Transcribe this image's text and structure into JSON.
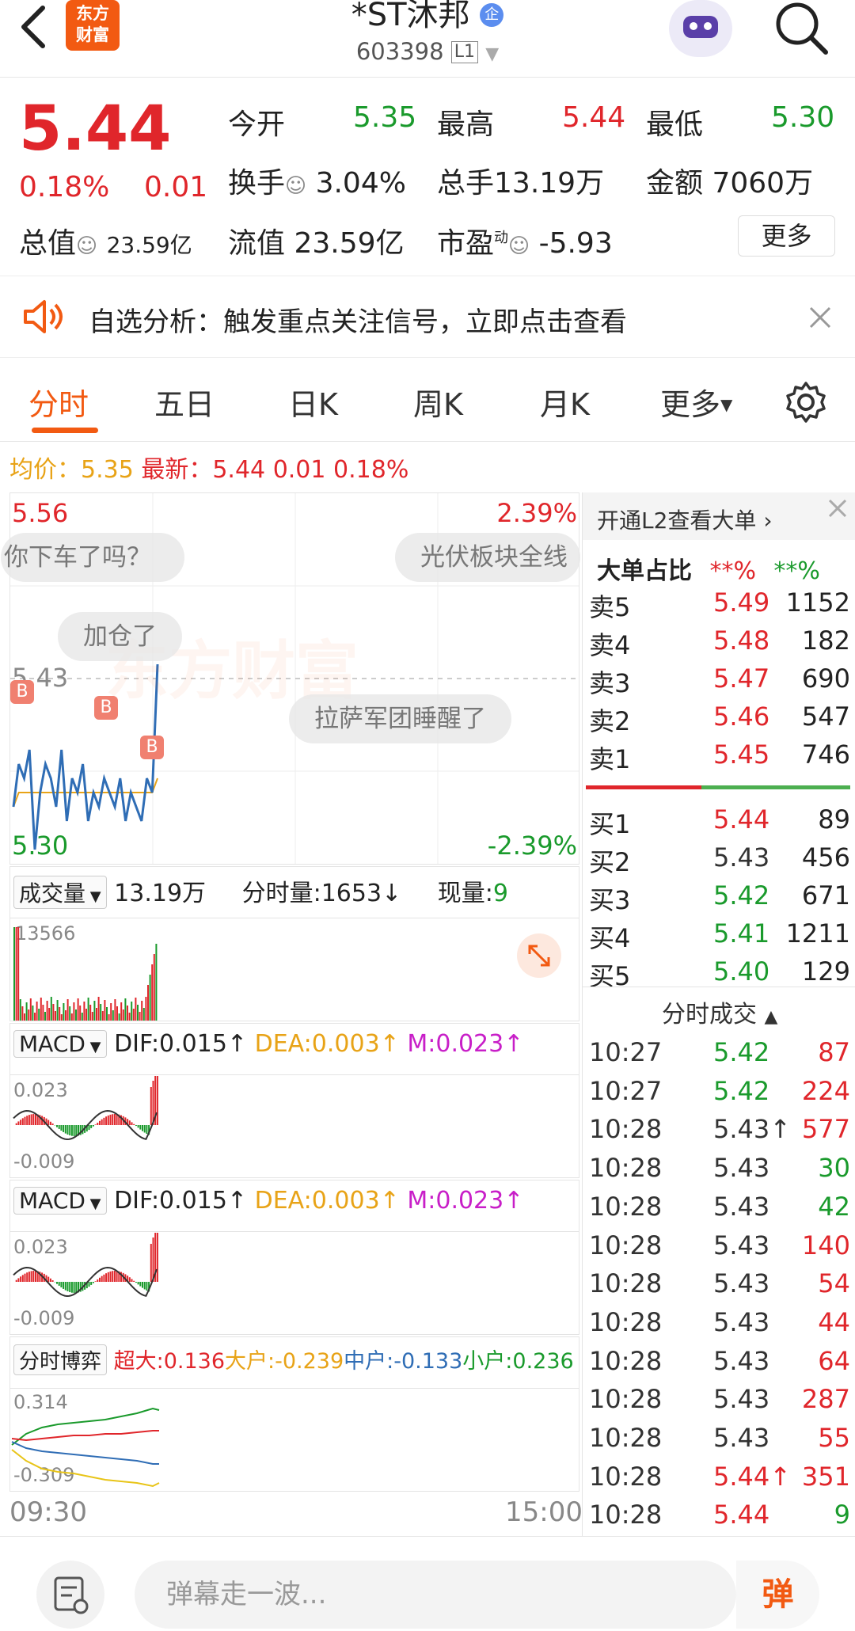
{
  "header": {
    "title": "*ST沐邦",
    "code": "603398",
    "level": "L1",
    "logo": [
      "东方",
      "财富"
    ]
  },
  "quote": {
    "price": "5.44",
    "change_pct": "0.18%",
    "change": "0.01",
    "open_label": "今开",
    "open": "5.35",
    "high_label": "最高",
    "high": "5.44",
    "low_label": "最低",
    "low": "5.30",
    "turnover_label": "换手",
    "turnover": "3.04%",
    "volume_label": "总手",
    "volume": "13.19万",
    "amount_label": "金额",
    "amount": "7060万",
    "mktcap_label": "总值",
    "mktcap": "23.59亿",
    "float_label": "流值",
    "float": "23.59亿",
    "pe_label": "市盈",
    "pe_sup": "动",
    "pe": "-5.93",
    "more": "更多"
  },
  "banner": {
    "text": "自选分析：触发重点关注信号，立即点击查看"
  },
  "tabs": [
    "分时",
    "五日",
    "日K",
    "周K",
    "月K",
    "更多"
  ],
  "avg_line": {
    "avg_label": "均价：",
    "avg": "5.35",
    "latest_label": "最新：",
    "latest": "5.44",
    "chg": "0.01",
    "pct": "0.18%"
  },
  "chart": {
    "top_price": "5.56",
    "top_pct": "2.39%",
    "mid_price": "5.43",
    "bottom_price": "5.30",
    "bottom_pct": "-2.39%",
    "start_time": "09:30",
    "end_time": "15:00",
    "watermark": "东方财富",
    "bubbles": [
      "你下车了吗？",
      "光伏板块全线",
      "加仓了",
      "拉萨军团睡醒了"
    ],
    "buy_marker": "B"
  },
  "chart_data": {
    "type": "line",
    "title": "",
    "series": [
      {
        "values": [
          5.34,
          5.37,
          5.36,
          5.38,
          5.31,
          5.35,
          5.37,
          5.36,
          5.34,
          5.38,
          5.33,
          5.36,
          5.35,
          5.37,
          5.33,
          5.35,
          5.34,
          5.36,
          5.35,
          5.34,
          5.36,
          5.33,
          5.35,
          5.34,
          5.33,
          5.36,
          5.35,
          5.44
        ]
      },
      {
        "values": [
          5.34,
          5.35,
          5.35,
          5.35,
          5.35,
          5.35,
          5.35,
          5.35,
          5.35,
          5.35,
          5.35,
          5.35,
          5.35,
          5.35,
          5.35,
          5.35,
          5.35,
          5.35,
          5.35,
          5.35,
          5.35,
          5.35,
          5.35,
          5.35,
          5.35,
          5.35,
          5.35,
          5.36
        ]
      }
    ],
    "ylim": [
      5.3,
      5.56
    ]
  },
  "volume": {
    "label": "成交量",
    "total": "13.19万",
    "min_label": "分时量:",
    "min_val": "1653",
    "now_label": "现量:",
    "now_val": "9",
    "max": "13566"
  },
  "macd1": {
    "label": "MACD",
    "dif": "DIF:0.015↑",
    "dea": "DEA:0.003↑",
    "m": "M:0.023↑",
    "top": "0.023",
    "bottom": "-0.009"
  },
  "macd2": {
    "label": "MACD",
    "dif": "DIF:0.015↑",
    "dea": "DEA:0.003↑",
    "m": "M:0.023↑",
    "top": "0.023",
    "bottom": "-0.009"
  },
  "game": {
    "label": "分时博弈",
    "super": "超大:0.136",
    "big": "大户:-0.239",
    "mid": "中户:-0.133",
    "small": "小户:0.236",
    "top": "0.314",
    "bottom": "-0.309"
  },
  "orderbook": {
    "l2_text": "开通L2查看大单",
    "big_order_label": "大单占比",
    "big_red": "**%",
    "big_green": "**%",
    "asks": [
      {
        "label": "卖5",
        "price": "5.49",
        "vol": "1152"
      },
      {
        "label": "卖4",
        "price": "5.48",
        "vol": "182"
      },
      {
        "label": "卖3",
        "price": "5.47",
        "vol": "690"
      },
      {
        "label": "卖2",
        "price": "5.46",
        "vol": "547"
      },
      {
        "label": "卖1",
        "price": "5.45",
        "vol": "746"
      }
    ],
    "bids": [
      {
        "label": "买1",
        "price": "5.44",
        "vol": "89"
      },
      {
        "label": "买2",
        "price": "5.43",
        "vol": "456"
      },
      {
        "label": "买3",
        "price": "5.42",
        "vol": "671"
      },
      {
        "label": "买4",
        "price": "5.41",
        "vol": "1211"
      },
      {
        "label": "买5",
        "price": "5.40",
        "vol": "129"
      }
    ],
    "ask_colors": [
      "#e0262b",
      "#e0262b",
      "#e0262b",
      "#e0262b",
      "#e0262b"
    ],
    "bid_colors": [
      "#e0262b",
      "#333333",
      "#1a9a2c",
      "#1a9a2c",
      "#1a9a2c"
    ],
    "trades_label": "分时成交",
    "trades": [
      {
        "t": "10:27",
        "p": "5.42",
        "v": "87",
        "pc": "#1a9a2c",
        "vc": "#e0262b"
      },
      {
        "t": "10:27",
        "p": "5.42",
        "v": "224",
        "pc": "#1a9a2c",
        "vc": "#e0262b"
      },
      {
        "t": "10:28",
        "p": "5.43↑",
        "v": "577",
        "pc": "#333333",
        "vc": "#e0262b"
      },
      {
        "t": "10:28",
        "p": "5.43",
        "v": "30",
        "pc": "#333333",
        "vc": "#1a9a2c"
      },
      {
        "t": "10:28",
        "p": "5.43",
        "v": "42",
        "pc": "#333333",
        "vc": "#1a9a2c"
      },
      {
        "t": "10:28",
        "p": "5.43",
        "v": "140",
        "pc": "#333333",
        "vc": "#e0262b"
      },
      {
        "t": "10:28",
        "p": "5.43",
        "v": "54",
        "pc": "#333333",
        "vc": "#e0262b"
      },
      {
        "t": "10:28",
        "p": "5.43",
        "v": "44",
        "pc": "#333333",
        "vc": "#e0262b"
      },
      {
        "t": "10:28",
        "p": "5.43",
        "v": "64",
        "pc": "#333333",
        "vc": "#e0262b"
      },
      {
        "t": "10:28",
        "p": "5.43",
        "v": "287",
        "pc": "#333333",
        "vc": "#e0262b"
      },
      {
        "t": "10:28",
        "p": "5.43",
        "v": "55",
        "pc": "#333333",
        "vc": "#e0262b"
      },
      {
        "t": "10:28",
        "p": "5.44↑",
        "v": "351",
        "pc": "#e0262b",
        "vc": "#e0262b"
      },
      {
        "t": "10:28",
        "p": "5.44",
        "v": "9",
        "pc": "#e0262b",
        "vc": "#1a9a2c"
      }
    ]
  },
  "bottom": {
    "placeholder": "弹幕走一波...",
    "dan": "弹"
  },
  "colors": {
    "up": "#e0262b",
    "down": "#1a9a2c",
    "accent": "#f25a12",
    "avg": "#e8a317",
    "price_line": "#2f6db5"
  }
}
